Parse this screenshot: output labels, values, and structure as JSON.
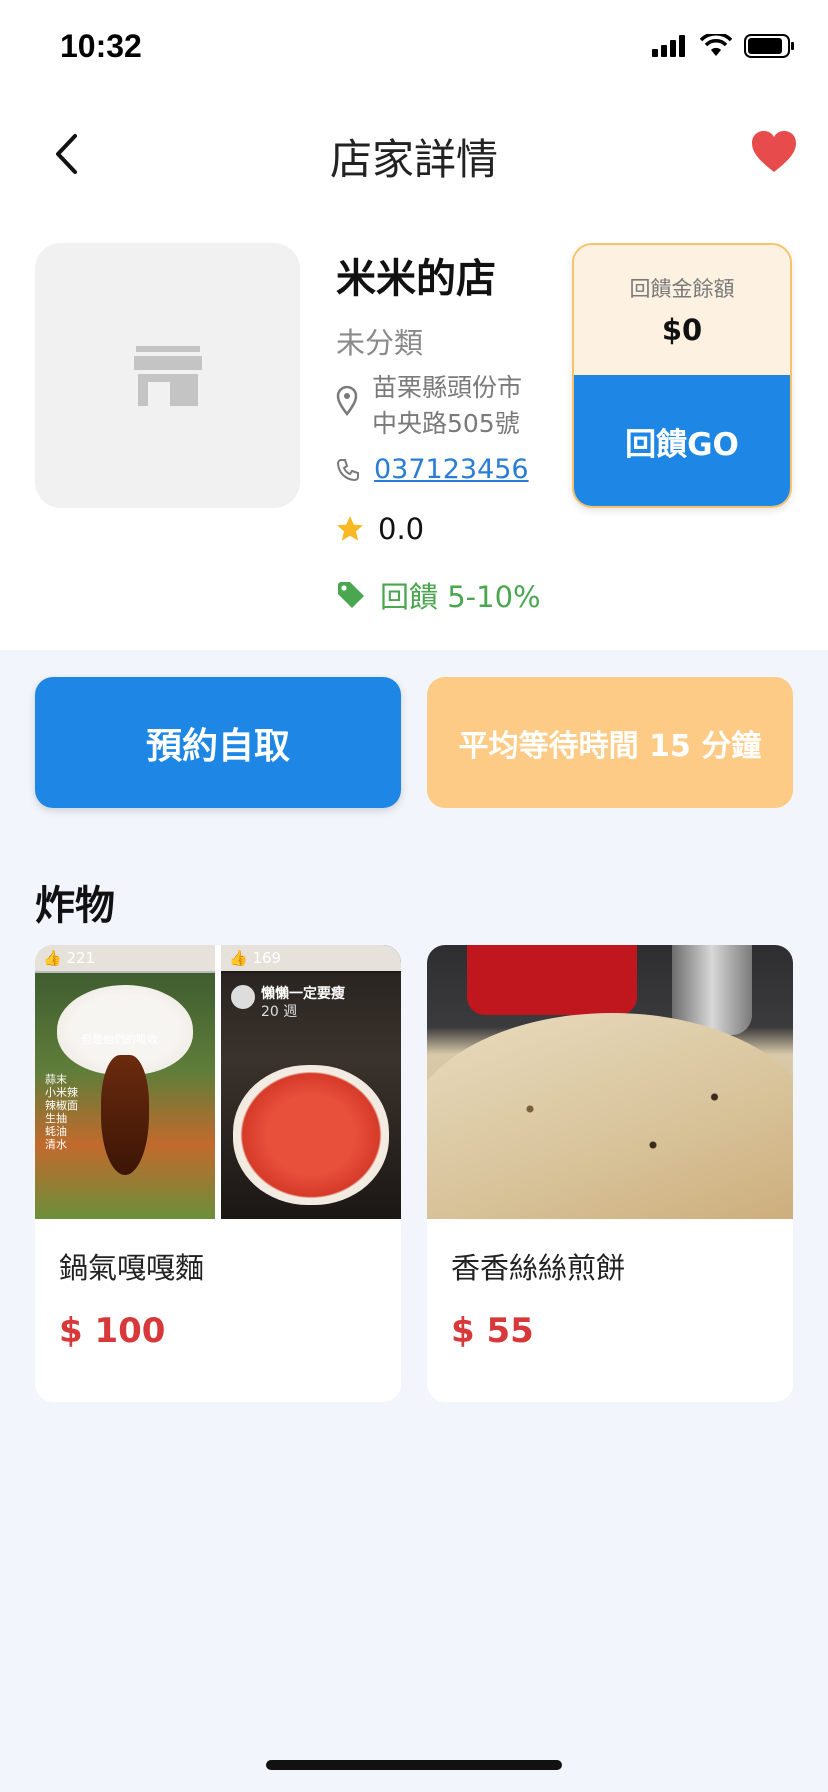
{
  "status_bar": {
    "time": "10:32"
  },
  "header": {
    "title": "店家詳情"
  },
  "store": {
    "name": "米米的店",
    "category": "未分類",
    "address": "苗栗縣頭份市中央路505號",
    "phone": "037123456",
    "rating": "0.0",
    "cashback": "回饋 5-10%"
  },
  "balance_card": {
    "label": "回饋金餘額",
    "value": "$0",
    "go_label": "回饋GO"
  },
  "actions": {
    "reserve_label": "預約自取",
    "wait_label": "平均等待時間 15 分鐘"
  },
  "menu": {
    "category": "炸物",
    "products": [
      {
        "name": "鍋氣嘎嘎麵",
        "price": "$ 100",
        "image_overlay": {
          "left_likes": "221",
          "right_likes": "169",
          "caption": "但是他們的吸收",
          "side_labels": "蒜末 小米辣 辣椒面 生抽 蚝油 清水",
          "author": "懶懶一定要瘦",
          "age": "20 週"
        }
      },
      {
        "name": "香香絲絲煎餅",
        "price": "$ 55"
      }
    ]
  },
  "colors": {
    "primary": "#1e87e5",
    "accent_orange": "#fdcb85",
    "price_red": "#d7393a",
    "cashback_green": "#4aa64f",
    "favorite_red": "#e84b4b"
  }
}
